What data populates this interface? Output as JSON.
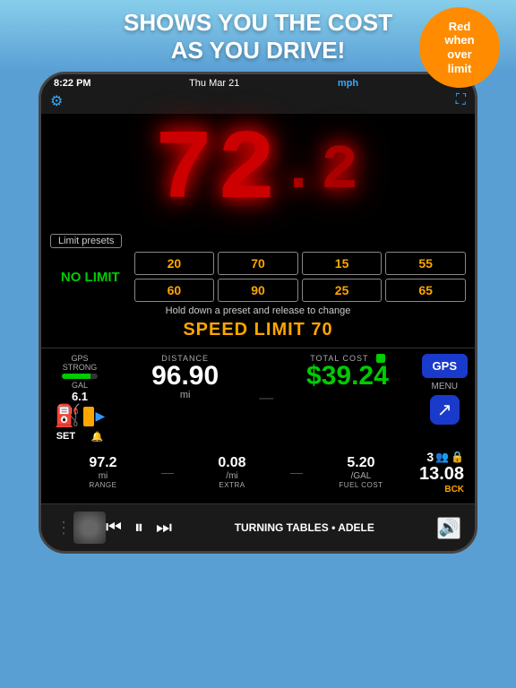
{
  "banner": {
    "line1": "SHOWS YOU THE COST",
    "line2": "AS YOU DRIVE!",
    "badge": "Red\nwhen\nover\nlimit"
  },
  "status_bar": {
    "time": "8:22 PM",
    "day": "Thu Mar 21",
    "unit": "mph",
    "menu_icon": "≡"
  },
  "speedometer": {
    "value": "72",
    "decimal": ".2"
  },
  "limit_presets": {
    "label": "Limit presets",
    "no_limit": "NO LIMIT",
    "presets": [
      "20",
      "70",
      "15",
      "55",
      "60",
      "90",
      "25",
      "65"
    ],
    "hold_text": "Hold down a preset and release to change",
    "speed_limit_text": "SPEED LIMIT 70"
  },
  "gps": {
    "label": "GPS",
    "strength": "STRONG",
    "gal_label": "GAL",
    "gal_value": "6.1",
    "set": "SET",
    "bell": "🔔"
  },
  "distance": {
    "label": "DISTANCE",
    "value": "96.90",
    "unit": "mi"
  },
  "total_cost": {
    "label": "TOTAL COST",
    "value": "$39.24"
  },
  "buttons": {
    "gps": "GPS",
    "menu": "MENU",
    "share_arrow": "↗"
  },
  "stats": {
    "range_value": "97.2",
    "range_unit": "mi",
    "range_label": "RANGE",
    "extra_value": "0.08",
    "extra_unit": "/mi",
    "extra_label": "EXTRA",
    "fuel_cost_value": "5.20",
    "fuel_cost_unit": "/GAL",
    "fuel_cost_label": "FUEL COST",
    "trip_count": "3",
    "trip_value": "13.08",
    "bck_label": "BCK"
  },
  "player": {
    "song": "TURNING TABLES • ADELE",
    "rewind": "⏮",
    "pause": "⏸",
    "forward": "⏭",
    "volume": "🔊"
  }
}
